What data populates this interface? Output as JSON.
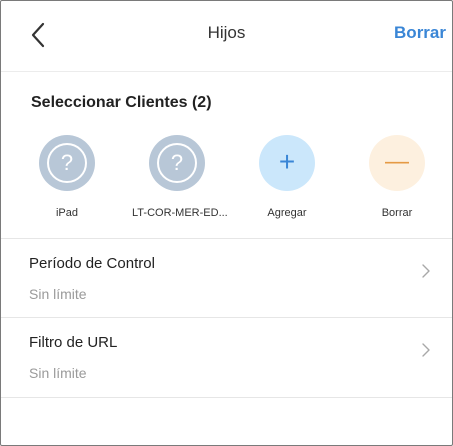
{
  "header": {
    "title": "Hijos",
    "right_action": "Borrar"
  },
  "section": {
    "title": "Seleccionar Clientes (2)"
  },
  "clients": [
    {
      "label": "iPad",
      "glyph": "?"
    },
    {
      "label": "LT-COR-MER-ED...",
      "glyph": "?"
    }
  ],
  "actions": {
    "add_label": "Agregar",
    "add_glyph": "+",
    "remove_label": "Borrar",
    "remove_glyph": "—"
  },
  "settings": [
    {
      "title": "Período de Control",
      "value": "Sin límite"
    },
    {
      "title": "Filtro de URL",
      "value": "Sin límite"
    }
  ],
  "colors": {
    "accent": "#3a86d6",
    "device_circle": "#b8c7d7",
    "add_circle": "#cbe7fb",
    "remove_circle": "#fdf0df",
    "callout_marker": "#e68a1e"
  }
}
